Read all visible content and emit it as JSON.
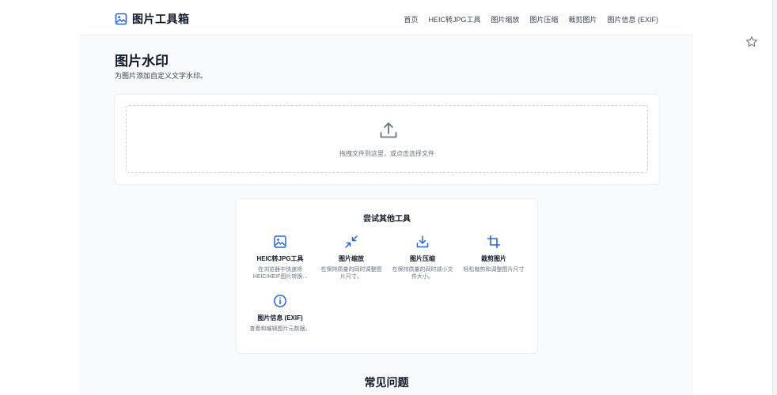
{
  "brand": {
    "name": "图片工具箱",
    "icon": "image-icon",
    "accent": "#2563eb"
  },
  "nav": [
    "首页",
    "HEIC转JPG工具",
    "图片缩放",
    "图片压缩",
    "裁剪图片",
    "图片信息 (EXIF)"
  ],
  "page": {
    "title": "图片水印",
    "subtitle": "为图片添加自定义文字水印。"
  },
  "upload": {
    "icon": "upload-icon",
    "text": "拖拽文件到这里，或点击选择文件"
  },
  "tools": {
    "title": "尝试其他工具",
    "items": [
      {
        "icon": "heic-image-icon",
        "name": "HEIC转JPG工具",
        "desc": "在浏览器中快速将HEIC/HEIF图片转换..."
      },
      {
        "icon": "resize-icon",
        "name": "图片缩放",
        "desc": "在保持质量的同时调整图片尺寸。"
      },
      {
        "icon": "compress-icon",
        "name": "图片压缩",
        "desc": "在保持质量的同时减小文件大小。"
      },
      {
        "icon": "crop-icon",
        "name": "裁剪图片",
        "desc": "轻松裁剪和调整图片尺寸"
      },
      {
        "icon": "info-icon",
        "name": "图片信息 (EXIF)",
        "desc": "查看和编辑图片元数据。"
      }
    ]
  },
  "faq": {
    "title": "常见问题"
  },
  "browser": {
    "bookmark_icon": "star-icon"
  }
}
